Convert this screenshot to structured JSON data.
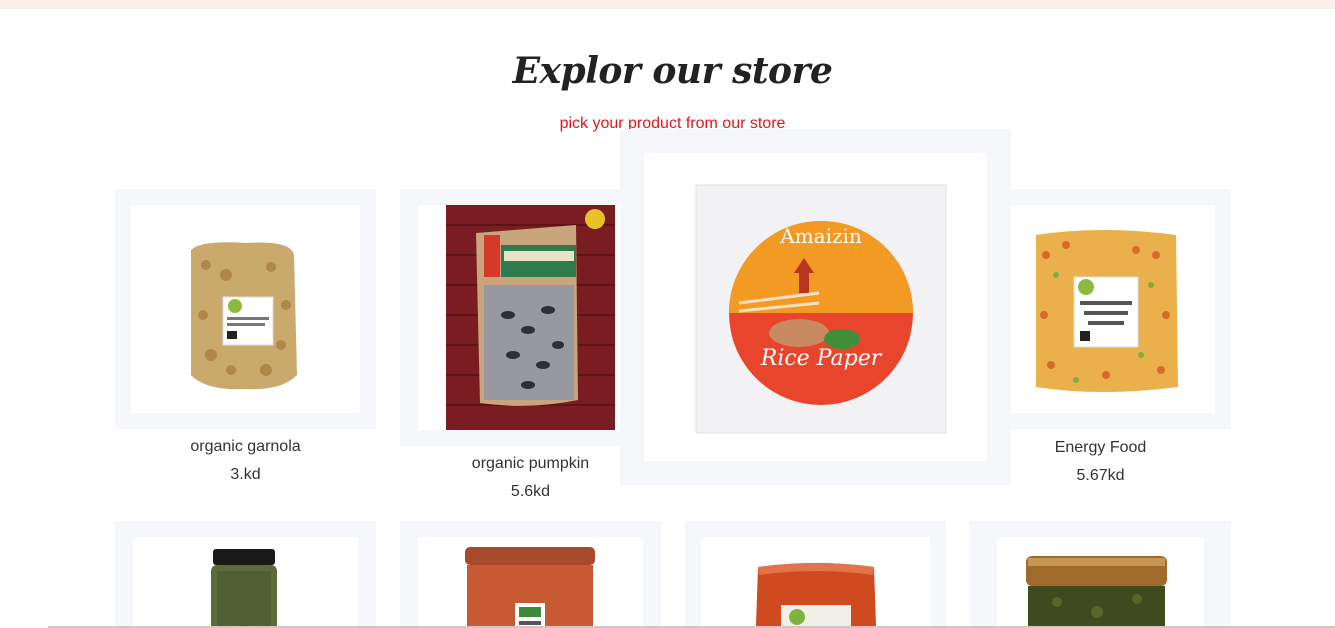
{
  "store": {
    "title": "Explor our store",
    "subtitle": "pick your product from our store"
  },
  "products": [
    {
      "name": "organic garnola",
      "price": "3.kd",
      "image": "granola-bag-image"
    },
    {
      "name": "organic pumpkin",
      "price": "5.6kd",
      "image": "pumpkin-seeds-bag-image"
    },
    {
      "name": "",
      "price": "",
      "image": "rice-paper-package-image",
      "brand_text": "Amaizin",
      "label_text": "Rice Paper"
    },
    {
      "name": "Energy Food",
      "price": "5.67kd",
      "image": "soup-mix-bag-image"
    },
    {
      "name": "",
      "price": "",
      "image": "herb-jar-image"
    },
    {
      "name": "",
      "price": "",
      "image": "now-real-food-tub-image"
    },
    {
      "name": "",
      "price": "",
      "image": "red-spice-bag-image"
    },
    {
      "name": "",
      "price": "",
      "image": "green-paste-jar-image"
    }
  ],
  "colors": {
    "subtitle": "#e01818",
    "card_bg": "#f5f7fa",
    "topbar": "#fbefe9"
  }
}
